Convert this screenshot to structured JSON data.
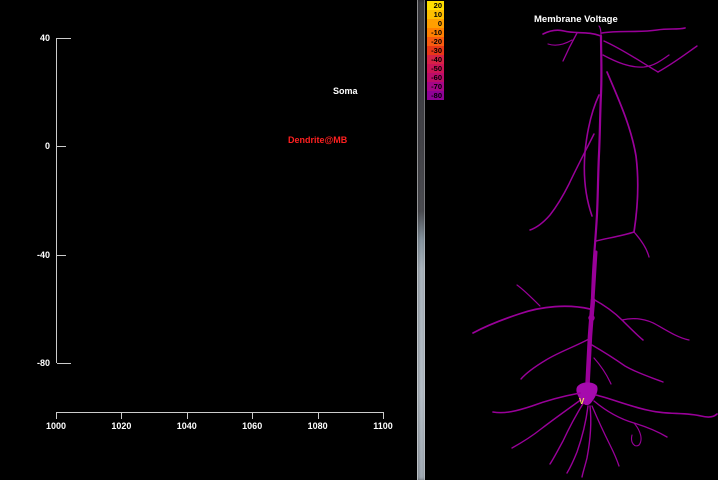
{
  "left_graph": {
    "axis_color": "#cccccc",
    "background": "#000000",
    "y_ticks": [
      "40",
      "0",
      "-40",
      "-80"
    ],
    "x_ticks": [
      "1000",
      "1020",
      "1040",
      "1060",
      "1080",
      "1100"
    ],
    "trace_labels": [
      {
        "text": "Soma",
        "color": "#ffffff"
      },
      {
        "text": "Dendrite@MB",
        "color": "#ff2020"
      }
    ]
  },
  "chart_data": {
    "type": "line",
    "title": "",
    "xlabel": "",
    "ylabel": "",
    "xlim": [
      1000,
      1100
    ],
    "ylim": [
      -80,
      40
    ],
    "x_tick_values": [
      1000,
      1020,
      1040,
      1060,
      1080,
      1100
    ],
    "y_tick_values": [
      40,
      0,
      -40,
      -80
    ],
    "grid": false,
    "series": [
      {
        "name": "Soma",
        "color": "#ffffff",
        "values": []
      },
      {
        "name": "Dendrite@MB",
        "color": "#ff2020",
        "values": []
      }
    ],
    "note": "axes drawn, no trace data plotted yet"
  },
  "divider": {
    "top_color": "#46464c",
    "bottom_color": "#d6e1eb"
  },
  "shape_plot": {
    "title": "Membrane Voltage",
    "neuron_color": "#990099",
    "soma_color": "#a50aad",
    "marker_color": "#ffe060",
    "marker_glyph": "V",
    "color_scale": [
      {
        "label": "20",
        "color": "#ffdf00"
      },
      {
        "label": "10",
        "color": "#ffbf00"
      },
      {
        "label": "0",
        "color": "#ff9f00"
      },
      {
        "label": "-10",
        "color": "#ff8000"
      },
      {
        "label": "-20",
        "color": "#f85c10"
      },
      {
        "label": "-30",
        "color": "#e83818"
      },
      {
        "label": "-40",
        "color": "#d62246"
      },
      {
        "label": "-50",
        "color": "#cc1456"
      },
      {
        "label": "-60",
        "color": "#bc0c6a"
      },
      {
        "label": "-70",
        "color": "#a50687"
      },
      {
        "label": "-80",
        "color": "#8e0295"
      }
    ]
  }
}
